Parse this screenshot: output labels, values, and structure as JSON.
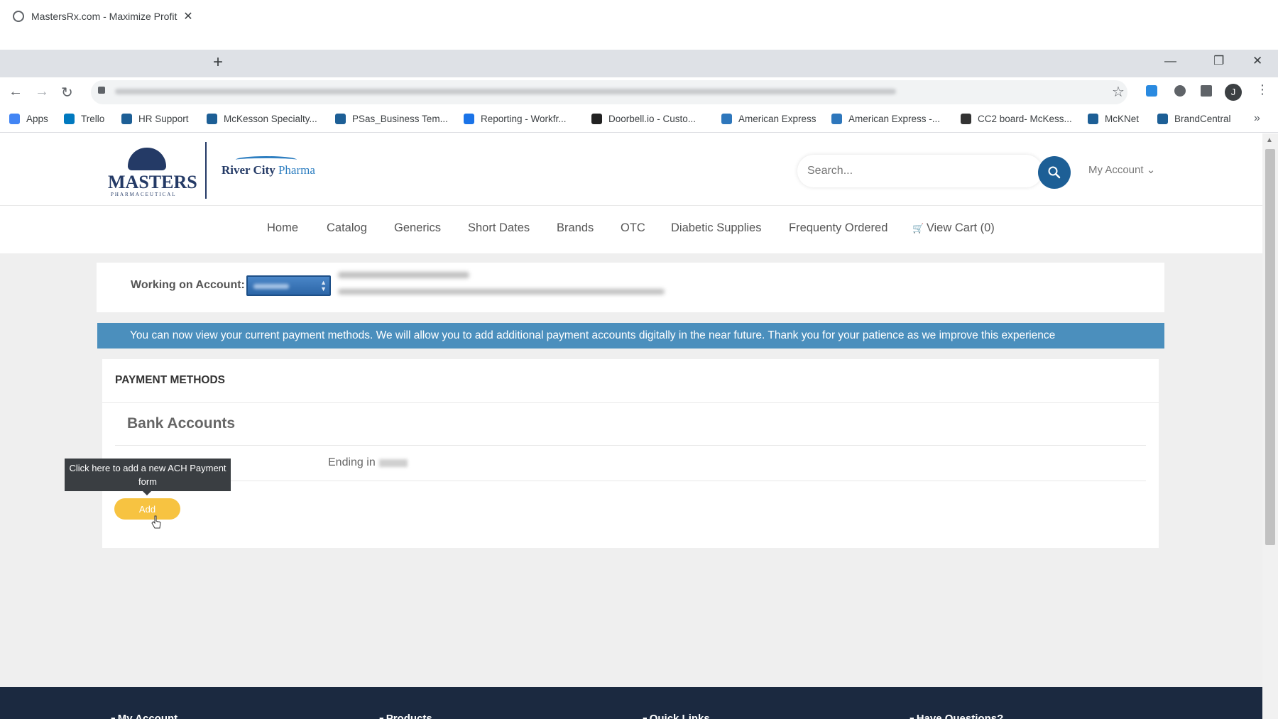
{
  "browser": {
    "tab_title": "MastersRx.com - Maximize Profit",
    "new_tab": "+",
    "tab_close": "✕",
    "window_controls": {
      "minimize": "—",
      "restore": "❐",
      "close": "✕"
    },
    "avatar_initial": "J",
    "bookmarks": [
      {
        "label": "Apps",
        "icon": "apps-grid-icon",
        "color": "#4285f4"
      },
      {
        "label": "Trello",
        "icon": "trello-icon",
        "color": "#0079bf"
      },
      {
        "label": "HR Support",
        "icon": "hr-support-icon",
        "color": "#1d5f96"
      },
      {
        "label": "McKesson Specialty...",
        "icon": "mckesson-icon",
        "color": "#1d5f96"
      },
      {
        "label": "PSas_Business Tem...",
        "icon": "psas-icon",
        "color": "#1d5f96"
      },
      {
        "label": "Reporting - Workfr...",
        "icon": "reporting-icon",
        "color": "#1a73e8"
      },
      {
        "label": "Doorbell.io - Custo...",
        "icon": "doorbell-icon",
        "color": "#222222"
      },
      {
        "label": "American Express",
        "icon": "amex-icon",
        "color": "#2e77bc"
      },
      {
        "label": "American Express -...",
        "icon": "amex-icon",
        "color": "#2e77bc"
      },
      {
        "label": "CC2 board- McKess...",
        "icon": "cc2-icon",
        "color": "#333333"
      },
      {
        "label": "McKNet",
        "icon": "mcknet-icon",
        "color": "#1d5f96"
      },
      {
        "label": "BrandCentral",
        "icon": "brandcentral-icon",
        "color": "#1d5f96"
      }
    ],
    "bookmarks_more": "»"
  },
  "site": {
    "logo_masters": "MASTERS",
    "logo_masters_sub": "PHARMACEUTICAL",
    "logo_rc_name": "River City",
    "logo_rc_pharma": "Pharma",
    "search_placeholder": "Search...",
    "my_account": "My Account ⌄",
    "nav": [
      "Home",
      "Catalog",
      "Generics",
      "Short Dates",
      "Brands",
      "OTC",
      "Diabetic Supplies",
      "Frequenty Ordered",
      "View Cart (0)"
    ],
    "colors": {
      "brand_navy": "#243a66",
      "accent_blue": "#1d5f96",
      "notice_bg": "#4b8fbd",
      "add_button": "#f7c341",
      "footer_bg": "#1b2940"
    }
  },
  "account": {
    "label": "Working on Account:"
  },
  "notice": {
    "text": "You can now view your current payment methods. We will allow you to add additional payment accounts digitally in the near future. Thank you for your patience as we improve this experience"
  },
  "payment_methods": {
    "heading": "PAYMENT METHODS",
    "bank_accounts_title": "Bank Accounts",
    "ending_in": "Ending in",
    "tooltip": "Click here to add a new ACH Payment form",
    "add_button": "Add"
  },
  "footer": {
    "items": [
      "My Account",
      "Products",
      "Quick Links",
      "Have Questions?"
    ]
  }
}
